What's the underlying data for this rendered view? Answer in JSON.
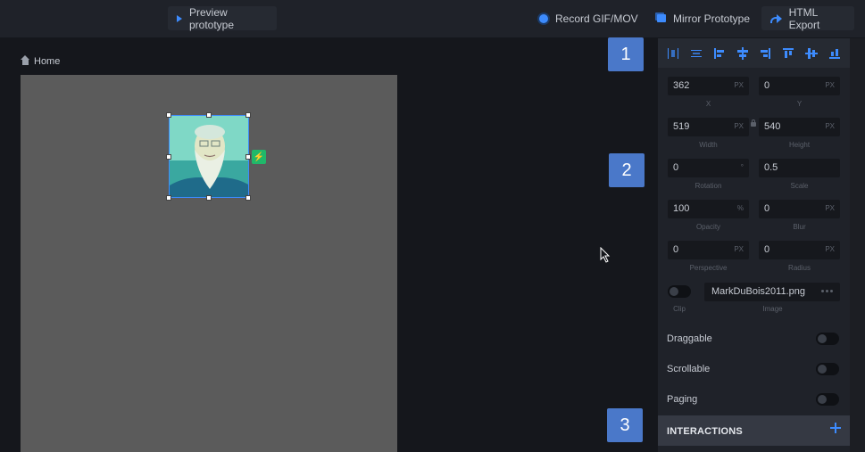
{
  "toolbar": {
    "preview_label": "Preview prototype",
    "record_label": "Record GIF/MOV",
    "mirror_label": "Mirror Prototype",
    "export_label": "HTML Export"
  },
  "breadcrumb": {
    "home_label": "Home"
  },
  "badges": [
    "1",
    "2",
    "3"
  ],
  "properties": {
    "x": {
      "value": "362",
      "unit": "PX",
      "label": "X"
    },
    "y": {
      "value": "0",
      "unit": "PX",
      "label": "Y"
    },
    "width": {
      "value": "519",
      "unit": "PX",
      "label": "Width"
    },
    "height": {
      "value": "540",
      "unit": "PX",
      "label": "Height"
    },
    "rotation": {
      "value": "0",
      "unit": "°",
      "label": "Rotation"
    },
    "scale": {
      "value": "0.5",
      "unit": "",
      "label": "Scale"
    },
    "opacity": {
      "value": "100",
      "unit": "%",
      "label": "Opacity"
    },
    "blur": {
      "value": "0",
      "unit": "PX",
      "label": "Blur"
    },
    "perspective": {
      "value": "0",
      "unit": "PX",
      "label": "Perspective"
    },
    "radius": {
      "value": "0",
      "unit": "PX",
      "label": "Radius"
    },
    "clip_label": "Clip",
    "image_file": "MarkDuBois2011.png",
    "image_label": "Image"
  },
  "toggles": {
    "draggable": "Draggable",
    "scrollable": "Scrollable",
    "paging": "Paging"
  },
  "interactions": {
    "label": "INTERACTIONS"
  },
  "colors": {
    "accent": "#3d8bfd",
    "badge": "#4a78c9",
    "bolt": "#20b86a"
  }
}
